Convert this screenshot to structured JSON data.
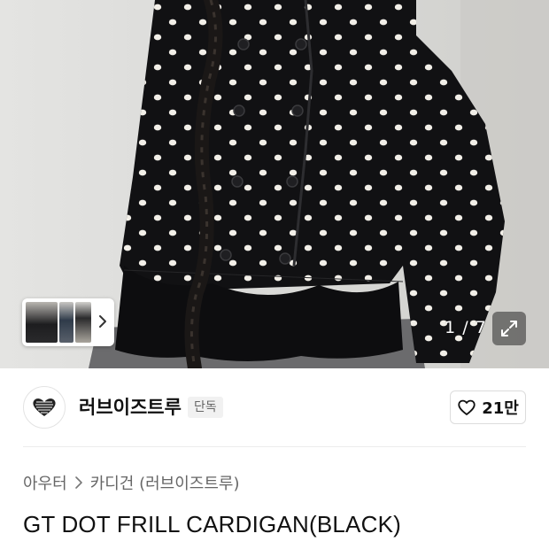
{
  "gallery": {
    "counter": "1 / 7",
    "thumbnail_strip": "thumbnail-strip",
    "icons": {
      "next": "chevron-right-icon",
      "expand": "expand-icon"
    }
  },
  "brand": {
    "name": "러브이즈트루",
    "badge": "단독",
    "logo_icon": "heart-logo-icon"
  },
  "like": {
    "count": "21만",
    "icon": "heart-outline-icon"
  },
  "breadcrumb": {
    "category": "아우터",
    "subcategory": "카디건 (러브이즈트루)"
  },
  "product": {
    "title": "GT DOT FRILL CARDIGAN(BLACK)"
  },
  "colors": {
    "text_primary": "#111111",
    "text_secondary": "#666666",
    "badge_bg": "#f1f1f1",
    "border": "#dcdcdc"
  }
}
